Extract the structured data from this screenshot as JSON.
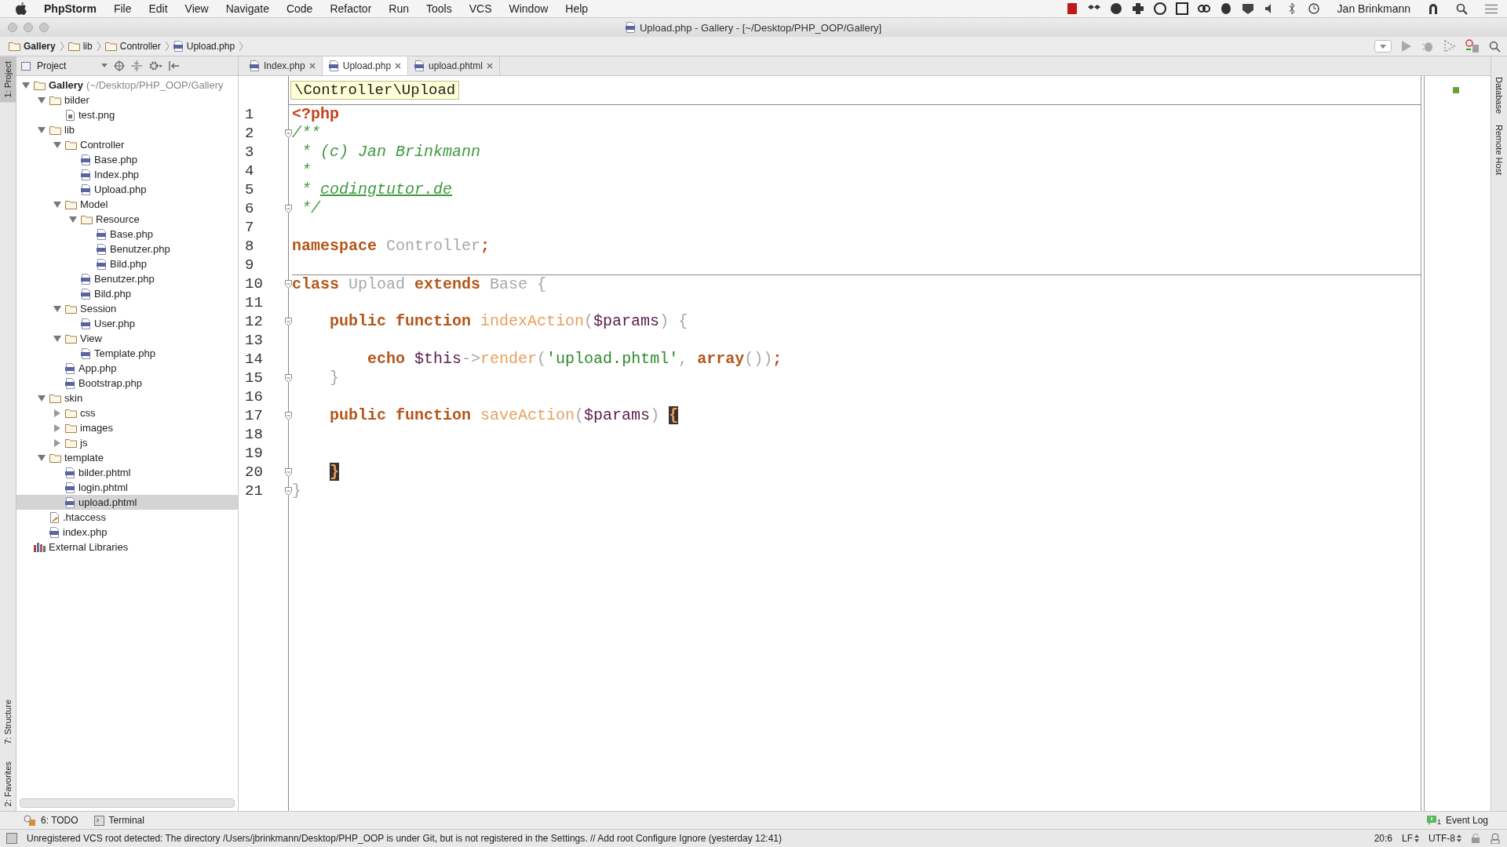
{
  "menu_bar": {
    "app": "PhpStorm",
    "items": [
      "File",
      "Edit",
      "View",
      "Navigate",
      "Code",
      "Refactor",
      "Run",
      "Tools",
      "VCS",
      "Window",
      "Help"
    ],
    "user": "Jan Brinkmann"
  },
  "window": {
    "title": "Upload.php - Gallery - [~/Desktop/PHP_OOP/Gallery]"
  },
  "breadcrumb": [
    {
      "label": "Gallery",
      "kind": "folder"
    },
    {
      "label": "lib",
      "kind": "folder"
    },
    {
      "label": "Controller",
      "kind": "folder"
    },
    {
      "label": "Upload.php",
      "kind": "php"
    }
  ],
  "left_strip": {
    "top": [
      {
        "label": "1: Project",
        "selected": true
      }
    ],
    "bottom": [
      {
        "label": "7: Structure",
        "selected": false
      },
      {
        "label": "2: Favorites",
        "selected": false
      }
    ]
  },
  "right_strip": [
    {
      "label": "Database"
    },
    {
      "label": "Remote Host"
    }
  ],
  "project_panel": {
    "title": "Project",
    "root": {
      "label": "Gallery",
      "path": "(~/Desktop/PHP_OOP/Gallery",
      "kind": "folder",
      "expanded": true,
      "selected": false,
      "children": [
        {
          "label": "bilder",
          "kind": "folder",
          "expanded": true,
          "selected": false,
          "children": [
            {
              "label": "test.png",
              "kind": "image",
              "selected": false
            }
          ]
        },
        {
          "label": "lib",
          "kind": "folder",
          "expanded": true,
          "selected": false,
          "children": [
            {
              "label": "Controller",
              "kind": "folder",
              "expanded": true,
              "selected": false,
              "children": [
                {
                  "label": "Base.php",
                  "kind": "php",
                  "selected": false
                },
                {
                  "label": "Index.php",
                  "kind": "php",
                  "selected": false
                },
                {
                  "label": "Upload.php",
                  "kind": "php",
                  "selected": false
                }
              ]
            },
            {
              "label": "Model",
              "kind": "folder",
              "expanded": true,
              "selected": false,
              "children": [
                {
                  "label": "Resource",
                  "kind": "folder",
                  "expanded": true,
                  "selected": false,
                  "children": [
                    {
                      "label": "Base.php",
                      "kind": "php",
                      "selected": false
                    },
                    {
                      "label": "Benutzer.php",
                      "kind": "php",
                      "selected": false
                    },
                    {
                      "label": "Bild.php",
                      "kind": "php",
                      "selected": false
                    }
                  ]
                },
                {
                  "label": "Benutzer.php",
                  "kind": "php",
                  "selected": false
                },
                {
                  "label": "Bild.php",
                  "kind": "php",
                  "selected": false
                }
              ]
            },
            {
              "label": "Session",
              "kind": "folder",
              "expanded": true,
              "selected": false,
              "children": [
                {
                  "label": "User.php",
                  "kind": "php",
                  "selected": false
                }
              ]
            },
            {
              "label": "View",
              "kind": "folder",
              "expanded": true,
              "selected": false,
              "children": [
                {
                  "label": "Template.php",
                  "kind": "php",
                  "selected": false
                }
              ]
            },
            {
              "label": "App.php",
              "kind": "php",
              "selected": false
            },
            {
              "label": "Bootstrap.php",
              "kind": "php",
              "selected": false
            }
          ]
        },
        {
          "label": "skin",
          "kind": "folder",
          "expanded": true,
          "selected": false,
          "children": [
            {
              "label": "css",
              "kind": "folder",
              "expanded": false,
              "selected": false
            },
            {
              "label": "images",
              "kind": "folder",
              "expanded": false,
              "selected": false
            },
            {
              "label": "js",
              "kind": "folder",
              "expanded": false,
              "selected": false
            }
          ]
        },
        {
          "label": "template",
          "kind": "folder",
          "expanded": true,
          "selected": false,
          "children": [
            {
              "label": "bilder.phtml",
              "kind": "php",
              "selected": false
            },
            {
              "label": "login.phtml",
              "kind": "php",
              "selected": false
            },
            {
              "label": "upload.phtml",
              "kind": "php",
              "selected": true
            }
          ]
        },
        {
          "label": ".htaccess",
          "kind": "config",
          "selected": false
        },
        {
          "label": "index.php",
          "kind": "php",
          "selected": false
        }
      ]
    },
    "extra": [
      {
        "label": "External Libraries",
        "kind": "library",
        "selected": false
      }
    ]
  },
  "tabs": [
    {
      "label": "Index.php",
      "selected": false
    },
    {
      "label": "Upload.php",
      "selected": true
    },
    {
      "label": "upload.phtml",
      "selected": false
    }
  ],
  "editor": {
    "scope": "\\Controller\\Upload",
    "lines": [
      {
        "number": "1",
        "fold": false,
        "separator": false,
        "tokens": [
          {
            "kind": "tag",
            "text": "<?php"
          }
        ]
      },
      {
        "number": "2",
        "fold": true,
        "separator": false,
        "tokens": [
          {
            "kind": "comment",
            "text": "/**"
          }
        ]
      },
      {
        "number": "3",
        "fold": false,
        "separator": false,
        "tokens": [
          {
            "kind": "comment",
            "text": " * (c) Jan Brinkmann"
          }
        ]
      },
      {
        "number": "4",
        "fold": false,
        "separator": false,
        "tokens": [
          {
            "kind": "comment",
            "text": " *"
          }
        ]
      },
      {
        "number": "5",
        "fold": false,
        "separator": false,
        "tokens": [
          {
            "kind": "comment",
            "text": " * "
          },
          {
            "kind": "comment-link",
            "text": "codingtutor.de"
          }
        ]
      },
      {
        "number": "6",
        "fold": true,
        "separator": false,
        "tokens": [
          {
            "kind": "comment",
            "text": " */"
          }
        ]
      },
      {
        "number": "7",
        "fold": false,
        "separator": false
      },
      {
        "number": "8",
        "fold": false,
        "separator": false,
        "tokens": [
          {
            "kind": "keyword",
            "text": "namespace"
          },
          {
            "kind": "name",
            "text": " Controller"
          },
          {
            "kind": "semicolon",
            "text": ";"
          }
        ]
      },
      {
        "number": "9",
        "fold": false,
        "separator": false
      },
      {
        "number": "10",
        "fold": true,
        "separator": true,
        "tokens": [
          {
            "kind": "keyword",
            "text": "class"
          },
          {
            "kind": "name",
            "text": " Upload"
          },
          {
            "kind": "keyword",
            "text": " extends"
          },
          {
            "kind": "name",
            "text": " Base {"
          }
        ]
      },
      {
        "number": "11",
        "fold": false,
        "separator": false
      },
      {
        "number": "12",
        "fold": true,
        "separator": false,
        "tokens": [
          {
            "kind": "keyword",
            "text": "    public function"
          },
          {
            "kind": "function",
            "text": " indexAction"
          },
          {
            "kind": "punct",
            "text": "("
          },
          {
            "kind": "variable",
            "text": "$params"
          },
          {
            "kind": "punct",
            "text": ") {"
          }
        ]
      },
      {
        "number": "13",
        "fold": false,
        "separator": false
      },
      {
        "number": "14",
        "fold": false,
        "separator": false,
        "tokens": [
          {
            "kind": "keyword",
            "text": "        echo"
          },
          {
            "kind": "variable",
            "text": " $this"
          },
          {
            "kind": "punct",
            "text": "->"
          },
          {
            "kind": "function",
            "text": "render"
          },
          {
            "kind": "punct",
            "text": "("
          },
          {
            "kind": "string",
            "text": "'upload.phtml'"
          },
          {
            "kind": "punct",
            "text": ", "
          },
          {
            "kind": "keyword",
            "text": "array"
          },
          {
            "kind": "punct",
            "text": "())"
          },
          {
            "kind": "semicolon",
            "text": ";"
          }
        ]
      },
      {
        "number": "15",
        "fold": true,
        "separator": false,
        "tokens": [
          {
            "kind": "punct",
            "text": "    }"
          }
        ]
      },
      {
        "number": "16",
        "fold": false,
        "separator": false
      },
      {
        "number": "17",
        "fold": true,
        "separator": false,
        "tokens": [
          {
            "kind": "keyword",
            "text": "    public function"
          },
          {
            "kind": "function",
            "text": " saveAction"
          },
          {
            "kind": "punct",
            "text": "("
          },
          {
            "kind": "variable",
            "text": "$params"
          },
          {
            "kind": "punct",
            "text": ") "
          },
          {
            "kind": "brace-match",
            "text": "{"
          }
        ]
      },
      {
        "number": "18",
        "fold": false,
        "separator": false
      },
      {
        "number": "19",
        "fold": false,
        "separator": false
      },
      {
        "number": "20",
        "fold": true,
        "separator": false,
        "tokens": [
          {
            "kind": "brace-match",
            "text": "    }"
          }
        ]
      },
      {
        "number": "21",
        "fold": true,
        "separator": false,
        "tokens": [
          {
            "kind": "punct",
            "text": "}"
          }
        ]
      }
    ]
  },
  "tool_bar": {
    "left": [
      {
        "label": "6: TODO",
        "kind": "todo"
      },
      {
        "label": "Terminal",
        "kind": "terminal"
      }
    ],
    "event_log": {
      "label": "Event Log",
      "count": "1"
    }
  },
  "status_bar": {
    "message": "Unregistered VCS root detected: The directory /Users/jbrinkmann/Desktop/PHP_OOP is under Git, but is not registered in the Settings. // Add root  Configure  Ignore (yesterday 12:41)",
    "position": "20:6",
    "line_separator": "LF",
    "encoding": "UTF-8"
  }
}
